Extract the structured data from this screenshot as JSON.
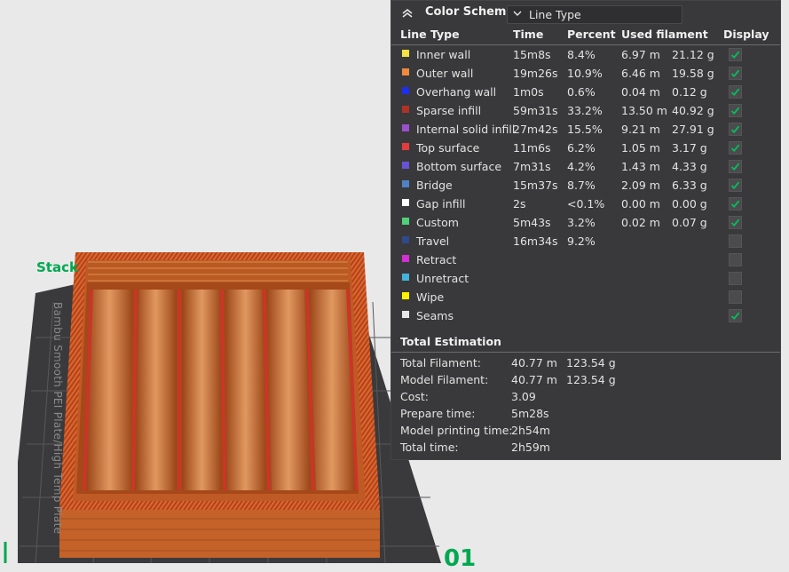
{
  "viewport": {
    "plate_label": "Stack",
    "plate_side_text": "Bambu Smooth PEI Plate/High Temp Plate",
    "axis_number": "01"
  },
  "legend": {
    "title": "Color Scheme",
    "scheme_select": {
      "value": "Line Type"
    },
    "columns": [
      "Line Type",
      "Time",
      "Percent",
      "Used filament",
      "Display"
    ],
    "rows": [
      {
        "name": "Inner wall",
        "color": "#f6e142",
        "time": "15m8s",
        "percent": "8.4%",
        "length": "6.97 m",
        "weight": "21.12 g",
        "display": true
      },
      {
        "name": "Outer wall",
        "color": "#f08a3e",
        "time": "19m26s",
        "percent": "10.9%",
        "length": "6.46 m",
        "weight": "19.58 g",
        "display": true
      },
      {
        "name": "Overhang wall",
        "color": "#1f2eec",
        "time": "1m0s",
        "percent": "0.6%",
        "length": "0.04 m",
        "weight": "0.12 g",
        "display": true
      },
      {
        "name": "Sparse infill",
        "color": "#b03128",
        "time": "59m31s",
        "percent": "33.2%",
        "length": "13.50 m",
        "weight": "40.92 g",
        "display": true
      },
      {
        "name": "Internal solid infill",
        "color": "#9b4fd0",
        "time": "27m42s",
        "percent": "15.5%",
        "length": "9.21 m",
        "weight": "27.91 g",
        "display": true
      },
      {
        "name": "Top surface",
        "color": "#e43c3c",
        "time": "11m6s",
        "percent": "6.2%",
        "length": "1.05 m",
        "weight": "3.17 g",
        "display": true
      },
      {
        "name": "Bottom surface",
        "color": "#6a52d6",
        "time": "7m31s",
        "percent": "4.2%",
        "length": "1.43 m",
        "weight": "4.33 g",
        "display": true
      },
      {
        "name": "Bridge",
        "color": "#4f82c4",
        "time": "15m37s",
        "percent": "8.7%",
        "length": "2.09 m",
        "weight": "6.33 g",
        "display": true
      },
      {
        "name": "Gap infill",
        "color": "#ffffff",
        "time": "2s",
        "percent": "<0.1%",
        "length": "0.00 m",
        "weight": "0.00 g",
        "display": true
      },
      {
        "name": "Custom",
        "color": "#4fd07a",
        "time": "5m43s",
        "percent": "3.2%",
        "length": "0.02 m",
        "weight": "0.07 g",
        "display": true
      },
      {
        "name": "Travel",
        "color": "#2f4a8a",
        "time": "16m34s",
        "percent": "9.2%",
        "length": "",
        "weight": "",
        "display": false
      },
      {
        "name": "Retract",
        "color": "#d42fd4",
        "time": "",
        "percent": "",
        "length": "",
        "weight": "",
        "display": false
      },
      {
        "name": "Unretract",
        "color": "#44b3da",
        "time": "",
        "percent": "",
        "length": "",
        "weight": "",
        "display": false
      },
      {
        "name": "Wipe",
        "color": "#fff200",
        "time": "",
        "percent": "",
        "length": "",
        "weight": "",
        "display": false
      },
      {
        "name": "Seams",
        "color": "#e6e6e6",
        "time": "",
        "percent": "",
        "length": "",
        "weight": "",
        "display": true
      }
    ],
    "total": {
      "title": "Total Estimation",
      "rows": [
        {
          "label": "Total Filament:",
          "v1": "40.77 m",
          "v2": "123.54 g"
        },
        {
          "label": "Model Filament:",
          "v1": "40.77 m",
          "v2": "123.54 g"
        },
        {
          "label": "Cost:",
          "v1": "3.09",
          "v2": ""
        },
        {
          "label": "Prepare time:",
          "v1": "5m28s",
          "v2": ""
        },
        {
          "label": "Model printing time:",
          "v1": "2h54m",
          "v2": ""
        },
        {
          "label": "Total time:",
          "v1": "2h59m",
          "v2": ""
        }
      ]
    }
  },
  "icons": {
    "collapse": "double-chevron-up-icon",
    "select_arrow": "chevron-down-icon",
    "check": "checkmark-icon"
  },
  "colors": {
    "accent_green": "#00a84f",
    "check_green": "#00c060",
    "panel_bg": "#39393b"
  }
}
